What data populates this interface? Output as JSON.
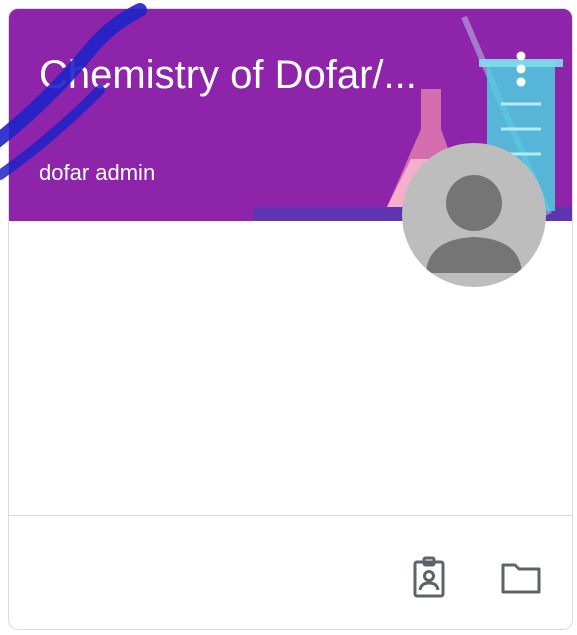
{
  "card": {
    "title": "Chemistry of Dofar/...",
    "owner": "dofar admin",
    "more_icon": "more-vert-icon",
    "avatar_icon": "person-avatar-icon"
  },
  "footer": {
    "actions": [
      {
        "icon": "assignment-ind-icon"
      },
      {
        "icon": "folder-icon"
      }
    ]
  },
  "colors": {
    "header_bg": "#8e24aa",
    "header_stripe": "#5e35b1",
    "avatar_bg": "#bdbdbd",
    "avatar_fg": "#757575",
    "icon": "#5f6368",
    "watermark": "#1e22c8"
  }
}
